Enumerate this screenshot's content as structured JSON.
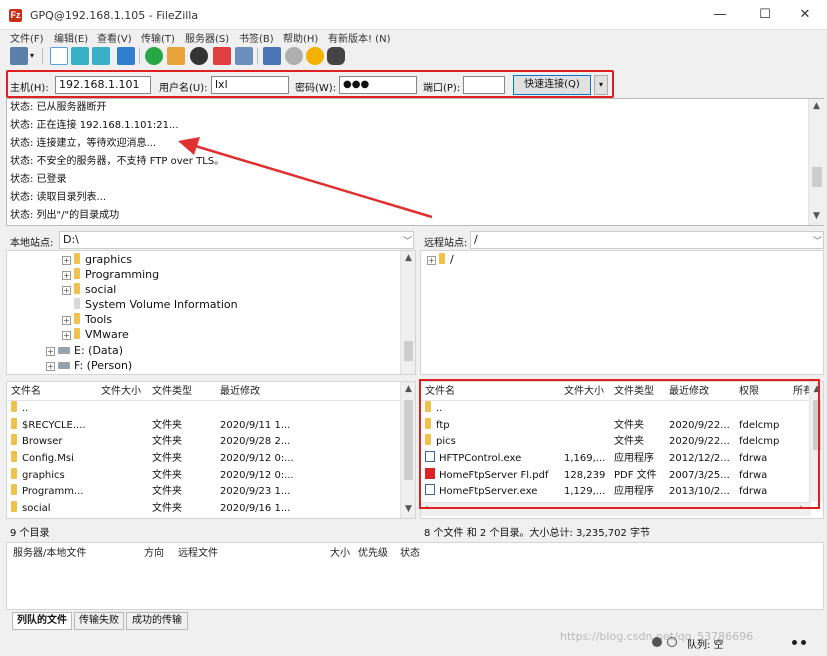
{
  "window": {
    "title": "GPQ@192.168.1.105 - FileZilla",
    "minimize": "—",
    "maximize": "☐",
    "close": "✕"
  },
  "menu": [
    "文件(F)",
    "编辑(E)",
    "查看(V)",
    "传输(T)",
    "服务器(S)",
    "书签(B)",
    "帮助(H)",
    "有新版本! (N)"
  ],
  "quickconnect": {
    "host_label": "主机(H):",
    "host_value": "192.168.1.101",
    "user_label": "用户名(U):",
    "user_value": "lxl",
    "pass_label": "密码(W):",
    "pass_value": "●●●",
    "port_label": "端口(P):",
    "port_value": "",
    "connect_label": "快速连接(Q)",
    "dropdown": "▾"
  },
  "log": [
    "状态: 已从服务器断开",
    "状态: 正在连接 192.168.1.101:21...",
    "状态: 连接建立，等待欢迎消息...",
    "状态: 不安全的服务器，不支持 FTP over TLS。",
    "状态: 已登录",
    "状态: 读取目录列表...",
    "状态: 列出\"/\"的目录成功"
  ],
  "local": {
    "site_label": "本地站点:",
    "site_value": "D:\\",
    "tree": [
      "graphics",
      "Programming",
      "social",
      "System Volume Information",
      "Tools",
      "VMware"
    ],
    "drives": [
      "E: (Data)",
      "F: (Person)"
    ],
    "headers": [
      "文件名",
      "文件大小",
      "文件类型",
      "最近修改"
    ],
    "files": [
      {
        "name": "..",
        "size": "",
        "type": "",
        "modified": ""
      },
      {
        "name": "$RECYCLE....",
        "size": "",
        "type": "文件夹",
        "modified": "2020/9/11 1..."
      },
      {
        "name": "Browser",
        "size": "",
        "type": "文件夹",
        "modified": "2020/9/28 2..."
      },
      {
        "name": "Config.Msi",
        "size": "",
        "type": "文件夹",
        "modified": "2020/9/12 0:..."
      },
      {
        "name": "graphics",
        "size": "",
        "type": "文件夹",
        "modified": "2020/9/12 0:..."
      },
      {
        "name": "Programm...",
        "size": "",
        "type": "文件夹",
        "modified": "2020/9/23 1..."
      },
      {
        "name": "social",
        "size": "",
        "type": "文件夹",
        "modified": "2020/9/16 1..."
      }
    ],
    "status": "9 个目录"
  },
  "remote": {
    "site_label": "远程站点:",
    "site_value": "/",
    "tree": [
      "/"
    ],
    "headers": [
      "文件名",
      "文件大小",
      "文件类型",
      "最近修改",
      "权限",
      "所有"
    ],
    "files": [
      {
        "name": "..",
        "size": "",
        "type": "",
        "modified": "",
        "perm": "",
        "icon": "folder"
      },
      {
        "name": "ftp",
        "size": "",
        "type": "文件夹",
        "modified": "2020/9/22...",
        "perm": "fdelcmp",
        "icon": "folder"
      },
      {
        "name": "pics",
        "size": "",
        "type": "文件夹",
        "modified": "2020/9/22...",
        "perm": "fdelcmp",
        "icon": "folder"
      },
      {
        "name": "HFTPControl.exe",
        "size": "1,169,...",
        "type": "应用程序",
        "modified": "2012/12/2...",
        "perm": "fdrwa",
        "icon": "exe"
      },
      {
        "name": "HomeFtpServer Fl.pdf",
        "size": "128,239",
        "type": "PDF 文件",
        "modified": "2007/3/25...",
        "perm": "fdrwa",
        "icon": "pdf"
      },
      {
        "name": "HomeFtpServer.exe",
        "size": "1,129,...",
        "type": "应用程序",
        "modified": "2013/10/2...",
        "perm": "fdrwa",
        "icon": "exe"
      }
    ],
    "status": "8 个文件 和 2 个目录。大小总计: 3,235,702 字节"
  },
  "queue": {
    "headers": [
      "服务器/本地文件",
      "方向",
      "远程文件",
      "大小",
      "优先级",
      "状态"
    ]
  },
  "tabs": [
    "列队的文件",
    "传输失败",
    "成功的传输"
  ],
  "statusbar": {
    "queue": "队列: 空",
    "watermark": "https://blog.csdn.net/qq_53786696"
  },
  "colors": {
    "highlight": "#e02020",
    "folder": "#f0c14b",
    "accent": "#0078d7"
  }
}
